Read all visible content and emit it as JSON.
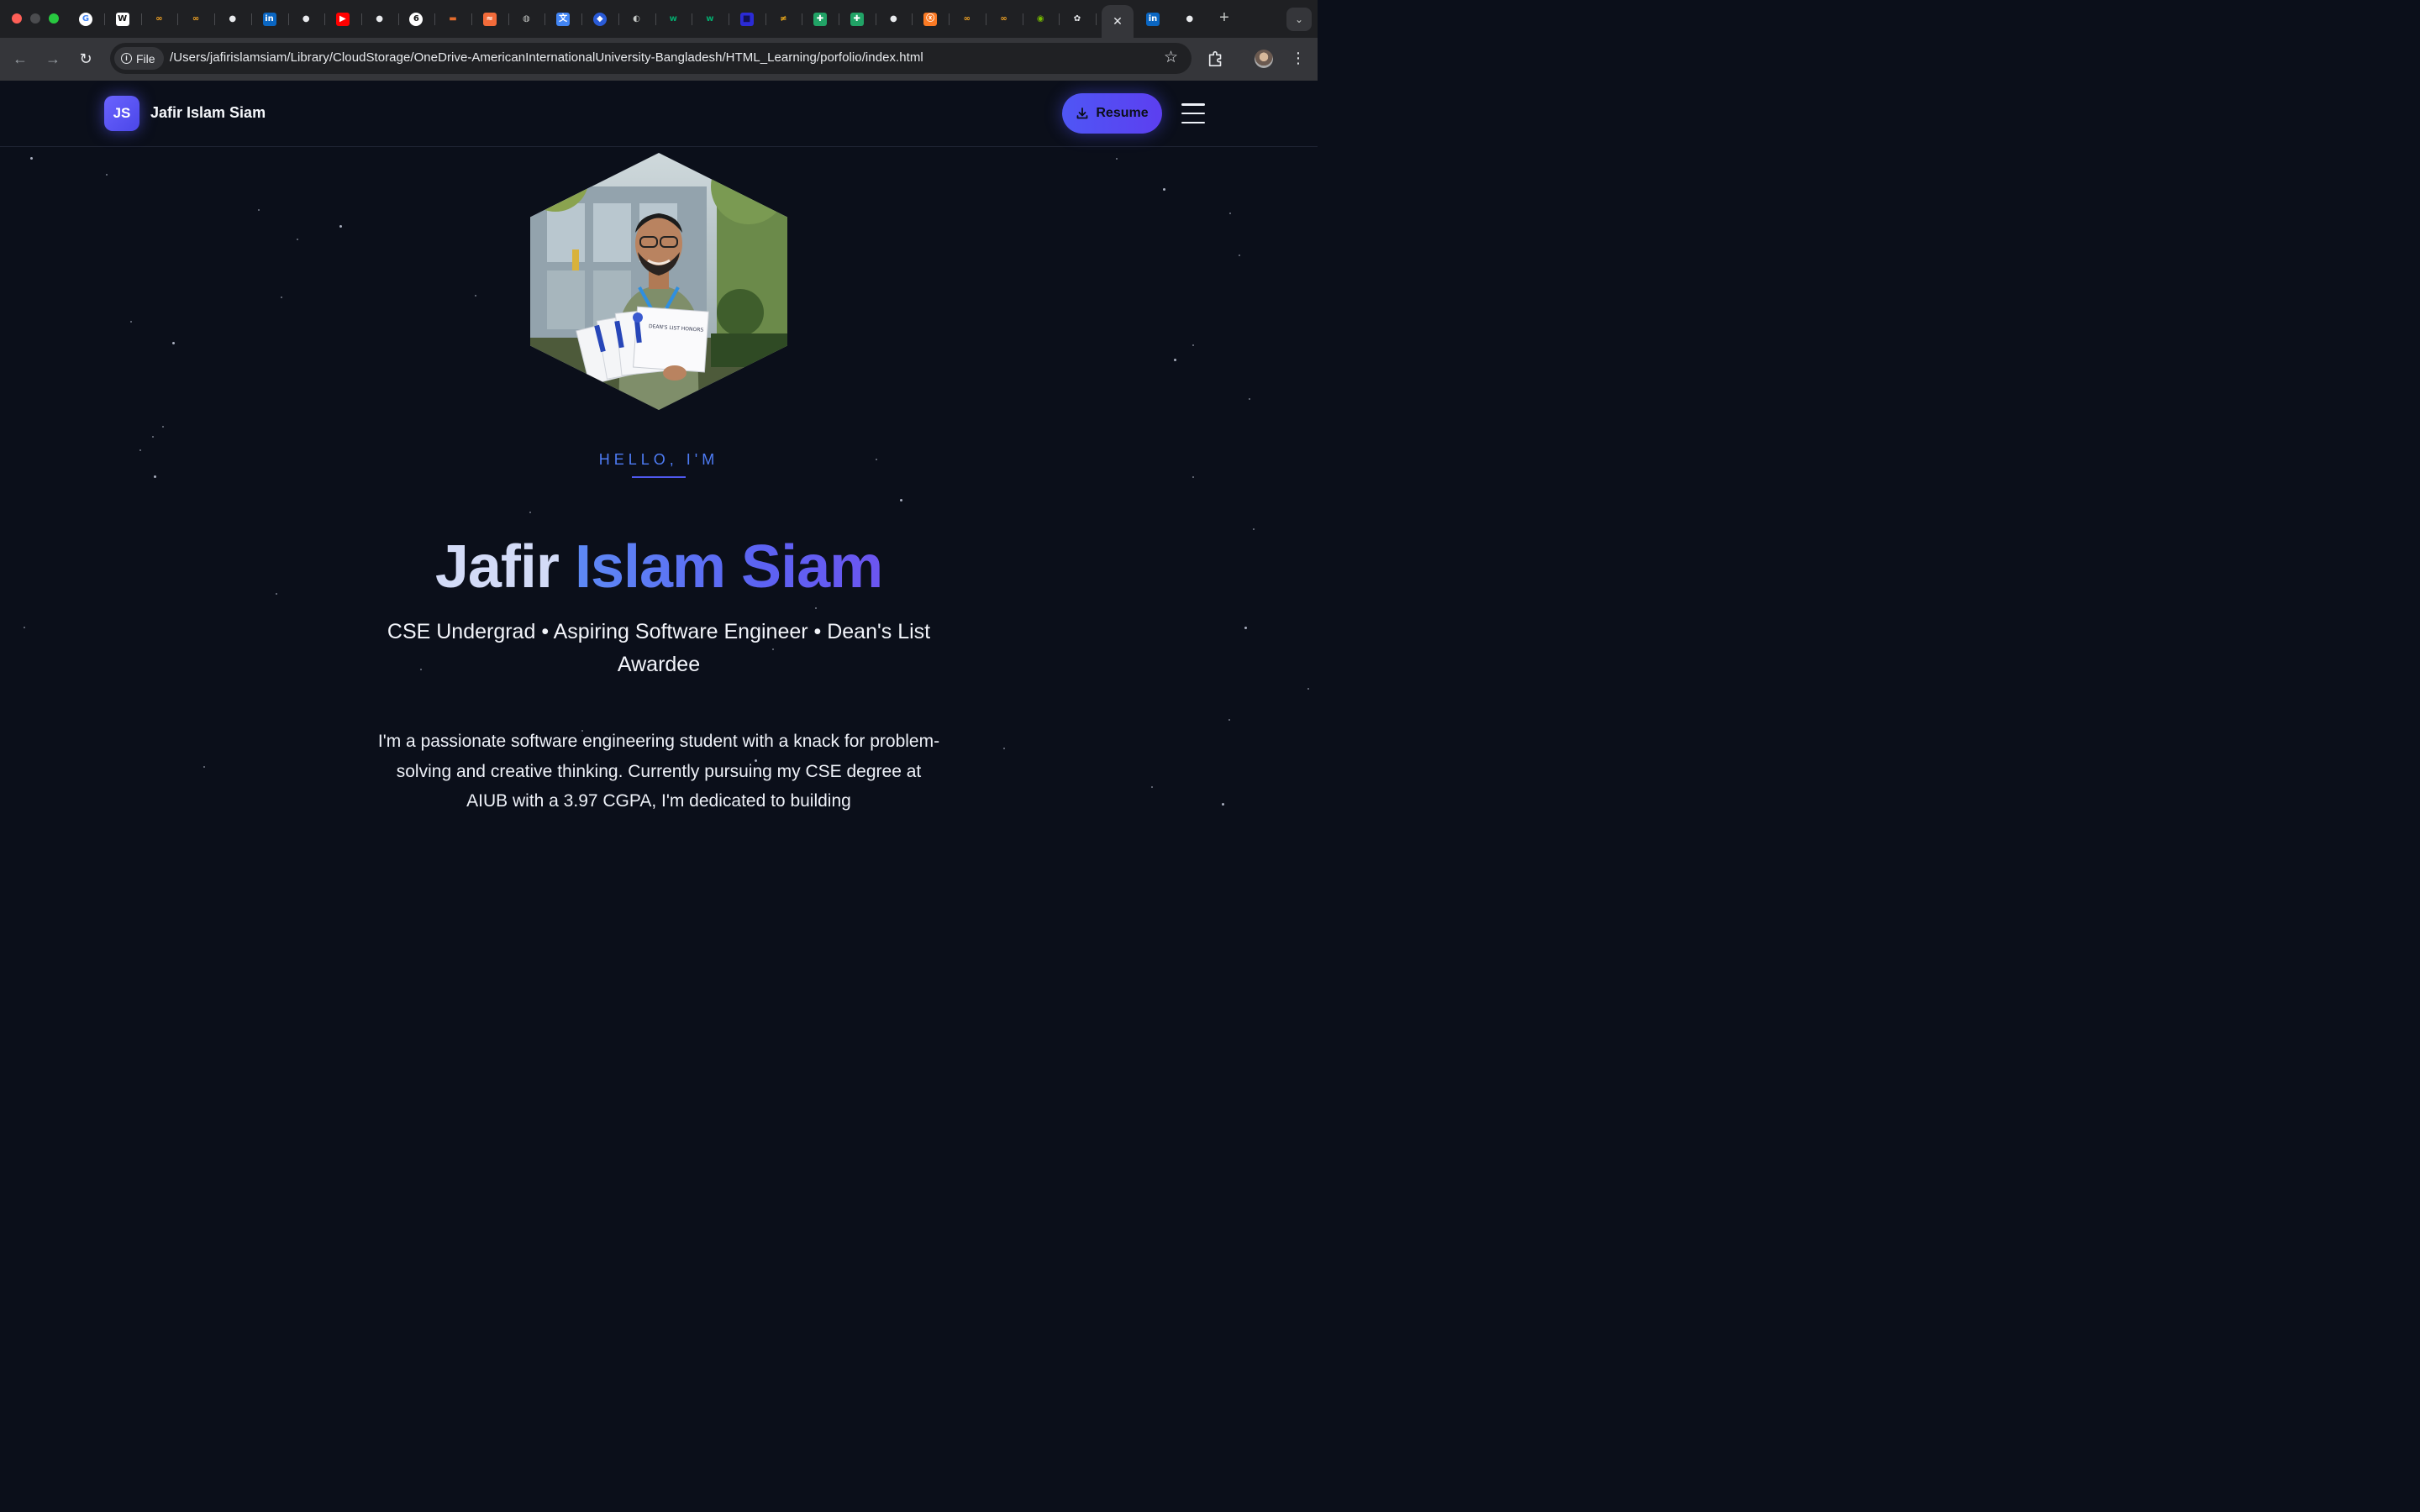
{
  "browser": {
    "tabs": [
      {
        "icon": "google-icon",
        "glyph": "G",
        "color": "#ffffff",
        "fg": "#4285f4",
        "round": true
      },
      {
        "icon": "wikipedia-icon",
        "glyph": "W",
        "color": "#ffffff",
        "fg": "#111111",
        "round": false
      },
      {
        "icon": "infinity-icon",
        "glyph": "∞",
        "color": "transparent",
        "fg": "#f5a524",
        "round": false
      },
      {
        "icon": "infinity-icon",
        "glyph": "∞",
        "color": "transparent",
        "fg": "#f5a524",
        "round": false
      },
      {
        "icon": "github-icon",
        "glyph": "●",
        "color": "transparent",
        "fg": "#e8eaed",
        "round": true
      },
      {
        "icon": "linkedin-icon",
        "glyph": "in",
        "color": "#0a66c2",
        "fg": "#ffffff",
        "round": false
      },
      {
        "icon": "github-icon",
        "glyph": "●",
        "color": "transparent",
        "fg": "#e8eaed",
        "round": true
      },
      {
        "icon": "youtube-icon",
        "glyph": "▶",
        "color": "#ff0000",
        "fg": "#ffffff",
        "round": false
      },
      {
        "icon": "github-icon",
        "glyph": "●",
        "color": "transparent",
        "fg": "#e8eaed",
        "round": true
      },
      {
        "icon": "refresh-circle-icon",
        "glyph": "6",
        "color": "#ffffff",
        "fg": "#111111",
        "round": true
      },
      {
        "icon": "bars-logo-icon",
        "glyph": "▬",
        "color": "transparent",
        "fg": "#e36b2c",
        "round": false
      },
      {
        "icon": "wave-icon",
        "glyph": "≈",
        "color": "#f26b3a",
        "fg": "#ffffff",
        "round": false
      },
      {
        "icon": "globe-icon",
        "glyph": "◍",
        "color": "transparent",
        "fg": "#c4c7c5",
        "round": true
      },
      {
        "icon": "translate-icon",
        "glyph": "文",
        "color": "#4285f4",
        "fg": "#ffffff",
        "round": false
      },
      {
        "icon": "shield-icon",
        "glyph": "◆",
        "color": "#2a5bd7",
        "fg": "#ffffff",
        "round": true
      },
      {
        "icon": "chat-icon",
        "glyph": "◐",
        "color": "transparent",
        "fg": "#c4c7c5",
        "round": true
      },
      {
        "icon": "w3schools-icon",
        "glyph": "w",
        "color": "transparent",
        "fg": "#04aa6d",
        "round": false
      },
      {
        "icon": "w3schools-icon",
        "glyph": "w",
        "color": "transparent",
        "fg": "#04aa6d",
        "round": false
      },
      {
        "icon": "square-logo-icon",
        "glyph": "■",
        "color": "#2b2bd6",
        "fg": "#111155",
        "round": false
      },
      {
        "icon": "slash-logo-icon",
        "glyph": "≠",
        "color": "transparent",
        "fg": "#e7a51a",
        "round": false
      },
      {
        "icon": "sheets-icon",
        "glyph": "✚",
        "color": "#21a366",
        "fg": "#ffffff",
        "round": false
      },
      {
        "icon": "sheets-icon",
        "glyph": "✚",
        "color": "#21a366",
        "fg": "#ffffff",
        "round": false
      },
      {
        "icon": "github-icon",
        "glyph": "●",
        "color": "transparent",
        "fg": "#e8eaed",
        "round": true
      },
      {
        "icon": "xampp-icon",
        "glyph": "ⓧ",
        "color": "#fb7a24",
        "fg": "#ffffff",
        "round": false
      },
      {
        "icon": "infinity-icon",
        "glyph": "∞",
        "color": "transparent",
        "fg": "#f5a524",
        "round": false
      },
      {
        "icon": "infinity-icon",
        "glyph": "∞",
        "color": "transparent",
        "fg": "#f5a524",
        "round": false
      },
      {
        "icon": "nvidia-icon",
        "glyph": "◉",
        "color": "transparent",
        "fg": "#76b900",
        "round": false
      },
      {
        "icon": "chatgpt-icon",
        "glyph": "✿",
        "color": "transparent",
        "fg": "#e8eaed",
        "round": true
      }
    ],
    "active_tab": {
      "close_glyph": "✕"
    },
    "tabs_after": [
      {
        "icon": "linkedin-icon",
        "glyph": "in",
        "color": "#0a66c2",
        "fg": "#ffffff",
        "round": false
      },
      {
        "icon": "github-icon",
        "glyph": "●",
        "color": "transparent",
        "fg": "#e8eaed",
        "round": true
      }
    ],
    "new_tab_glyph": "+",
    "tab_menu_glyph": "⌄",
    "back_glyph": "←",
    "forward_glyph": "→",
    "reload_glyph": "↻",
    "security_chip": "File",
    "url": "/Users/jafirislamsiam/Library/CloudStorage/OneDrive-AmericanInternationalUniversity-Bangladesh/HTML_Learning/porfolio/index.html",
    "bookmark_glyph": "☆",
    "menu_glyph": "⋮"
  },
  "site": {
    "logo_initials": "JS",
    "name": "Jafir Islam Siam",
    "resume_label": "Resume"
  },
  "hero": {
    "greeting": "HELLO, I'M",
    "name_first": "Jafir",
    "name_rest": "Islam Siam",
    "tagline": "CSE Undergrad • Aspiring Software Engineer • Dean's List Awardee",
    "intro": "I'm a passionate software engineering student with a knack for problem-solving and creative thinking. Currently pursuing my CSE degree at AIUB with a 3.97 CGPA, I'm dedicated to building",
    "certificate_text": "DEAN'S LIST HONORS"
  },
  "colors": {
    "accent": "#4f56f5",
    "accent_violet": "#5c3ff0",
    "greeting_blue": "#4e7cf5",
    "page_bg": "#0b0f1a"
  }
}
